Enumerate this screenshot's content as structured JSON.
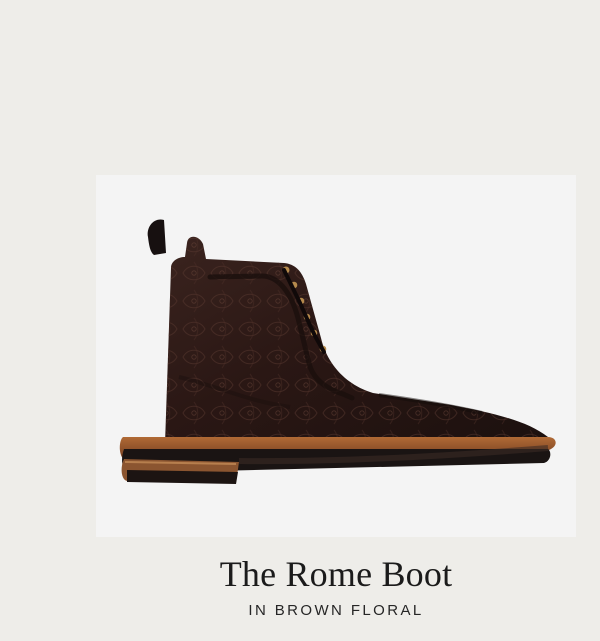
{
  "product": {
    "name": "The Rome Boot",
    "variant": "IN BROWN FLORAL",
    "image_icon": "boot-photo"
  },
  "colors": {
    "page_background": "#eeede9",
    "photo_background": "#f4f4f4",
    "leather": "#2d1a16",
    "sole_welt": "#8a4a26",
    "text": "#1b1b1b"
  }
}
